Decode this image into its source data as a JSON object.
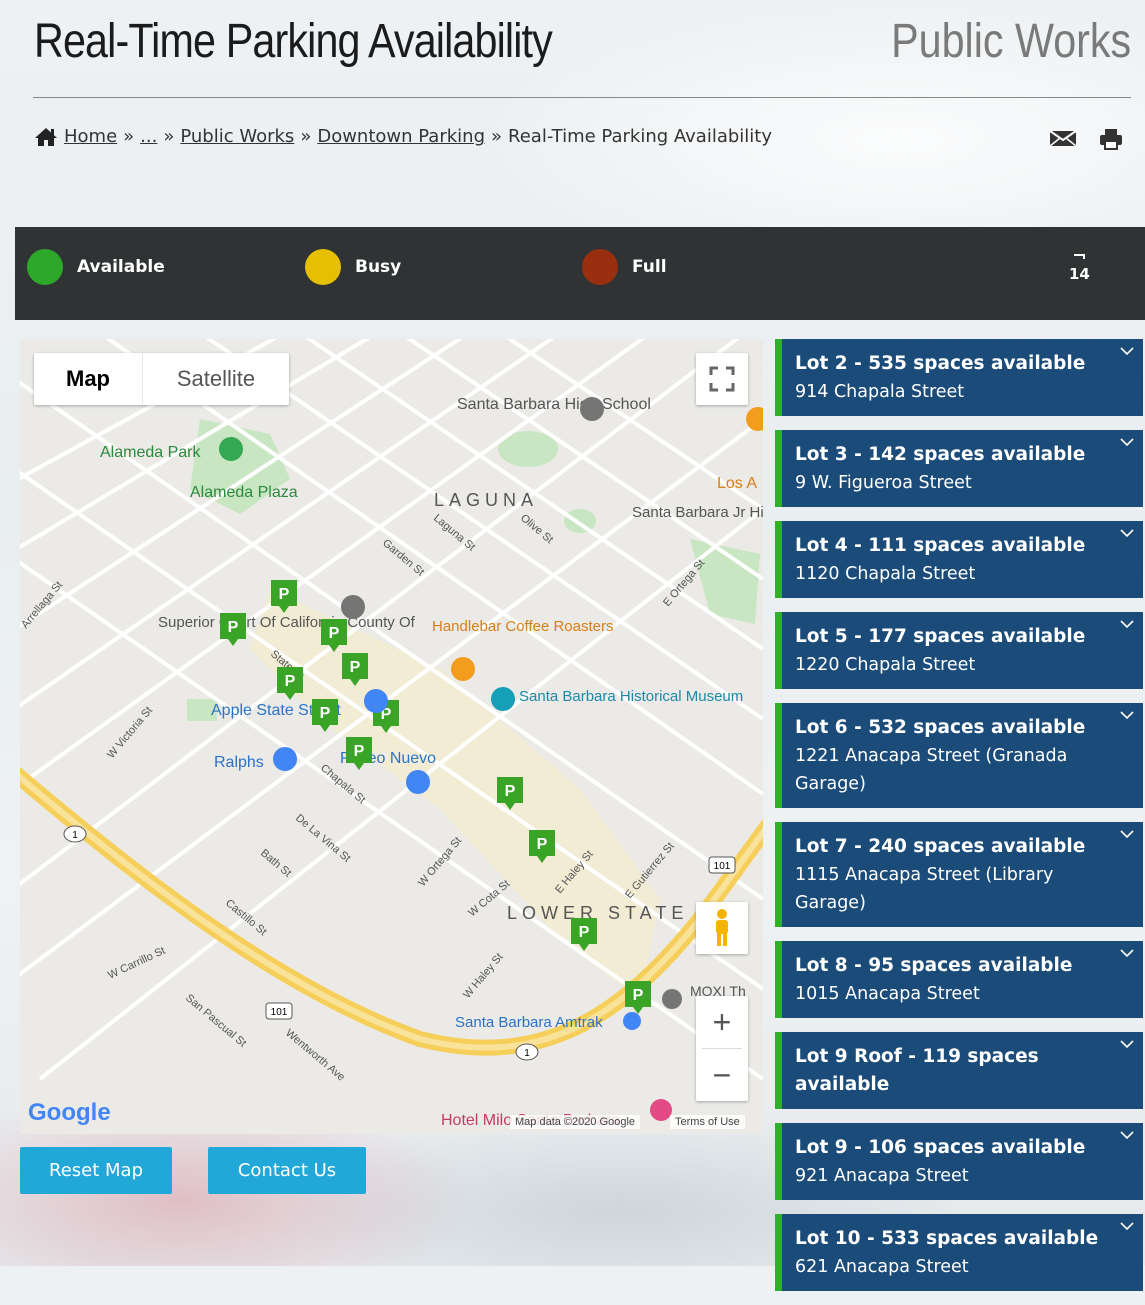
{
  "header": {
    "title": "Real-Time Parking Availability",
    "department": "Public Works"
  },
  "breadcrumb": {
    "home": "Home",
    "sep": "»",
    "ellipsis": "...",
    "level1": "Public Works",
    "level2": "Downtown Parking",
    "current": "Real-Time Parking Availability"
  },
  "legend": {
    "items": [
      {
        "label": "Available",
        "color": "#2ea82b"
      },
      {
        "label": "Busy",
        "color": "#e6bf00"
      },
      {
        "label": "Full",
        "color": "#9a2f10"
      }
    ],
    "count": "14"
  },
  "map": {
    "type_map": "Map",
    "type_satellite": "Satellite",
    "google": "Google",
    "attribution": "Map data ©2020 Google",
    "terms": "Terms of Use",
    "neighborhoods": [
      "LAGUNA",
      "LOWER STATE"
    ],
    "places": [
      "Santa Barbara High School",
      "Alameda Park",
      "Alameda Plaza",
      "Santa Barbara Jr High School",
      "Superior Court Of California County Of",
      "Handlebar Coffee Roasters",
      "Santa Barbara Historical Museum",
      "Apple State Street",
      "Ralphs",
      "Paseo Nuevo",
      "Santa Barbara Amtrak",
      "MOXI Th",
      "Hotel Milo Santa Barbara",
      "Los A"
    ],
    "streets": [
      "Garden St",
      "State St",
      "Chapala St",
      "De La Vina St",
      "Bath St",
      "W Carrillo St",
      "W Haley St",
      "E Haley St",
      "E Gutierrez St",
      "Castillo St",
      "Wentworth Ave",
      "San Pascual St",
      "Laguna St",
      "Olive St",
      "E Ortega St",
      "W Cota St",
      "W Ortega St",
      "W Victoria St",
      "Arrellaga St"
    ],
    "routes": [
      "1",
      "101"
    ],
    "marker_label": "P"
  },
  "buttons": {
    "reset": "Reset Map",
    "contact": "Contact Us"
  },
  "lots": [
    {
      "title": "Lot 2 - 535 spaces available",
      "address": "914 Chapala Street"
    },
    {
      "title": "Lot 3 - 142 spaces available",
      "address": "9 W. Figueroa Street"
    },
    {
      "title": "Lot 4 - 111 spaces available",
      "address": "1120 Chapala Street"
    },
    {
      "title": "Lot 5 - 177 spaces available",
      "address": "1220 Chapala Street"
    },
    {
      "title": "Lot 6 - 532 spaces available",
      "address": "1221 Anacapa Street (Granada Garage)"
    },
    {
      "title": "Lot 7 - 240 spaces available",
      "address": "1115 Anacapa Street (Library Garage)"
    },
    {
      "title": "Lot 8 - 95 spaces available",
      "address": "1015 Anacapa Street"
    },
    {
      "title": "Lot 9 Roof - 119 spaces available",
      "address": ""
    },
    {
      "title": "Lot 9 - 106 spaces available",
      "address": "921 Anacapa Street"
    },
    {
      "title": "Lot 10 - 533 spaces available",
      "address": "621 Anacapa Street"
    }
  ]
}
